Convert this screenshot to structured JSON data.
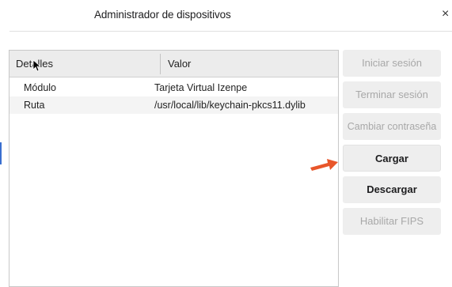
{
  "window": {
    "title": "Administrador de dispositivos",
    "close_glyph": "×"
  },
  "table": {
    "columns": [
      "Detalles",
      "Valor"
    ],
    "rows": [
      [
        "Módulo",
        "Tarjeta Virtual Izenpe"
      ],
      [
        "Ruta",
        "/usr/local/lib/keychain-pkcs11.dylib"
      ]
    ]
  },
  "buttons": {
    "login": "Iniciar sesión",
    "logout": "Terminar sesión",
    "change_password": "Cambiar contraseña",
    "load": "Cargar",
    "unload": "Descargar",
    "enable_fips": "Habilitar FIPS"
  },
  "icons": {
    "close": "close-icon",
    "cursor": "mouse-pointer-icon",
    "annotation": "arrow-right-icon"
  },
  "colors": {
    "annotation_arrow": "#e8562a",
    "button_bg": "#eeeeee",
    "disabled_text": "#a8a8a8"
  }
}
